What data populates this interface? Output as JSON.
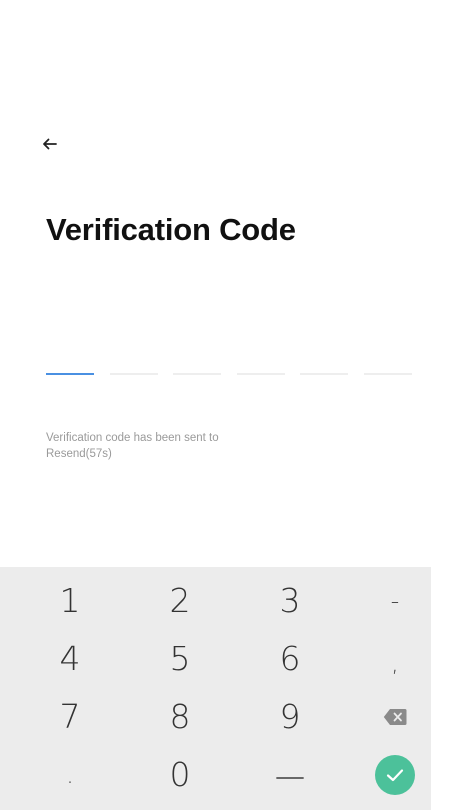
{
  "page": {
    "title": "Verification Code",
    "info_text": "Verification code has been sent to",
    "resend_label": "Resend(57s)"
  },
  "code_slots": [
    "",
    "",
    "",
    "",
    "",
    ""
  ],
  "keypad": {
    "rows": [
      [
        "1",
        "2",
        "3",
        "-"
      ],
      [
        "4",
        "5",
        "6",
        ","
      ],
      [
        "7",
        "8",
        "9",
        "delete"
      ],
      [
        ".",
        "0",
        "space",
        "enter"
      ]
    ],
    "icons": {
      "delete": "backspace-icon",
      "space": "space-bar-icon",
      "enter": "checkmark-icon"
    },
    "colors": {
      "background": "#ececec",
      "enter": "#4cc19a",
      "active_slot": "#4a90e2"
    }
  }
}
